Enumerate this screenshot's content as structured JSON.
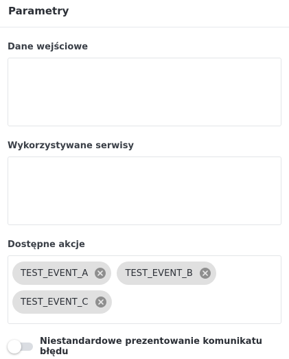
{
  "panel": {
    "title": "Parametry"
  },
  "fields": {
    "input_data": {
      "label": "Dane wejściowe",
      "value": ""
    },
    "services": {
      "label": "Wykorzystywane serwisy",
      "value": ""
    },
    "actions": {
      "label": "Dostępne akcje",
      "chips": [
        {
          "label": "TEST_EVENT_A"
        },
        {
          "label": "TEST_EVENT_B"
        },
        {
          "label": "TEST_EVENT_C"
        }
      ]
    }
  },
  "toggle": {
    "label": "Niestandardowe prezentowanie komunikatu błędu",
    "checked": false
  },
  "icons": {
    "chip_remove": "close-circle-icon"
  },
  "colors": {
    "chip_bg": "#e0e0e0",
    "chip_close_bg": "#8e8e8e",
    "border": "#e3e5e8"
  }
}
